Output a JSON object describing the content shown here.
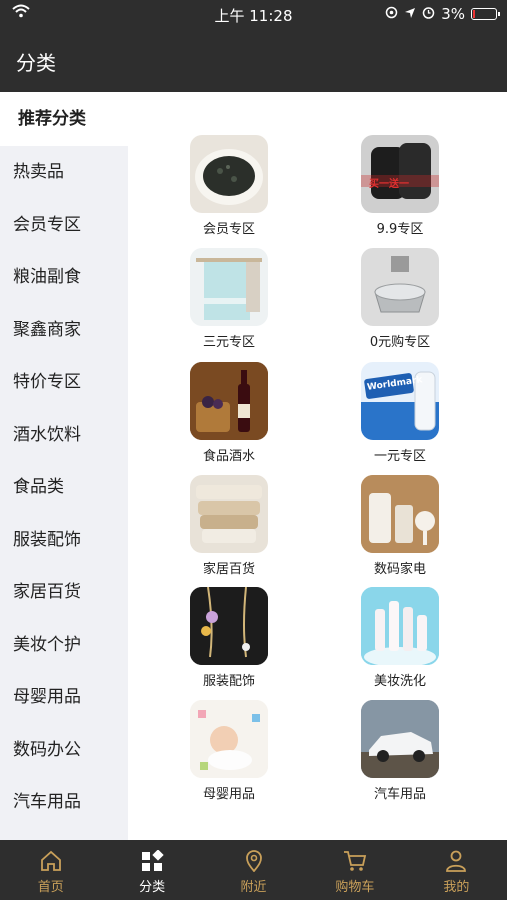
{
  "status": {
    "time": "上午 11:28",
    "battery": "3%"
  },
  "header": {
    "title": "分类"
  },
  "sidebar": {
    "items": [
      "推荐分类",
      "热卖品",
      "会员专区",
      "粮油副食",
      "聚鑫商家",
      "特价专区",
      "酒水饮料",
      "食品类",
      "服装配饰",
      "家居百货",
      "美妆个护",
      "母婴用品",
      "数码办公",
      "汽车用品"
    ]
  },
  "categories": [
    {
      "label": "会员专区"
    },
    {
      "label": "9.9专区"
    },
    {
      "label": "三元专区"
    },
    {
      "label": "0元购专区"
    },
    {
      "label": "食品酒水"
    },
    {
      "label": "一元专区"
    },
    {
      "label": "家居百货"
    },
    {
      "label": "数码家电"
    },
    {
      "label": "服装配饰"
    },
    {
      "label": "美妆洗化"
    },
    {
      "label": "母婴用品"
    },
    {
      "label": "汽车用品"
    }
  ],
  "thumb_texts": {
    "promo": "买一送一",
    "brand": "Worldmark"
  },
  "tabbar": {
    "items": [
      "首页",
      "分类",
      "附近",
      "购物车",
      "我的"
    ]
  },
  "colors": {
    "dark": "#2e2e2e",
    "gold": "#c9a05a",
    "sidebar_bg": "#f0f1f5"
  }
}
